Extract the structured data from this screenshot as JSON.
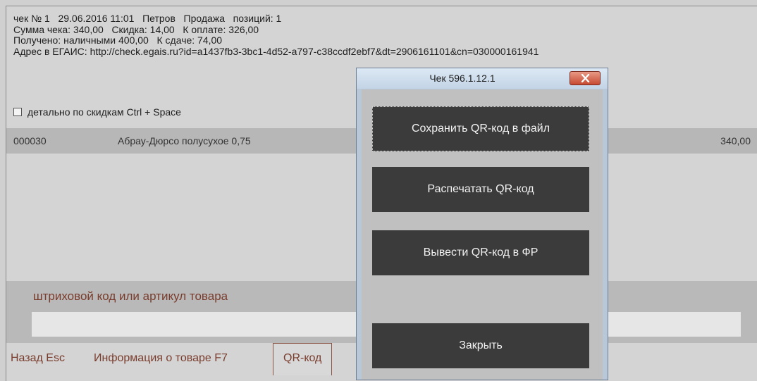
{
  "receipt": {
    "line1": "чек № 1   29.06.2016 11:01   Петров   Продажа   позиций: 1",
    "line2": "Сумма чека: 340,00   Скидка: 14,00   К оплате: 326,00",
    "line3": "Получено: наличными 400,00   К сдаче: 74,00",
    "line4": "Адрес в ЕГАИС: http://check.egais.ru?id=a1437fb3-3bc1-4d52-a797-c38ccdf2ebf7&dt=2906161101&cn=030000161941"
  },
  "detail_checkbox": {
    "label": "детально по скидкам Ctrl + Space",
    "checked": false
  },
  "items": [
    {
      "code": "000030",
      "name": "Абрау-Дюрсо полусухое 0,75",
      "amount": "340,00"
    }
  ],
  "barcode": {
    "label": "штриховой код или артикул товара",
    "value": ""
  },
  "bottom_buttons": {
    "back": "Назад Esc",
    "info": "Информация о товаре F7",
    "qr": "QR-код"
  },
  "dialog": {
    "title": "Чек 596.1.12.1",
    "save_qr": "Сохранить QR-код в файл",
    "print_qr": "Распечатать QR-код",
    "output_qr": "Вывести QR-код в ФР",
    "close": "Закрыть"
  },
  "colors": {
    "accent_text": "#7a3c2c",
    "dialog_button": "#3b3b3b",
    "close_button": "#c74a32"
  },
  "icons": {
    "close": "close-x-icon",
    "checkbox": "checkbox-unchecked-icon"
  }
}
